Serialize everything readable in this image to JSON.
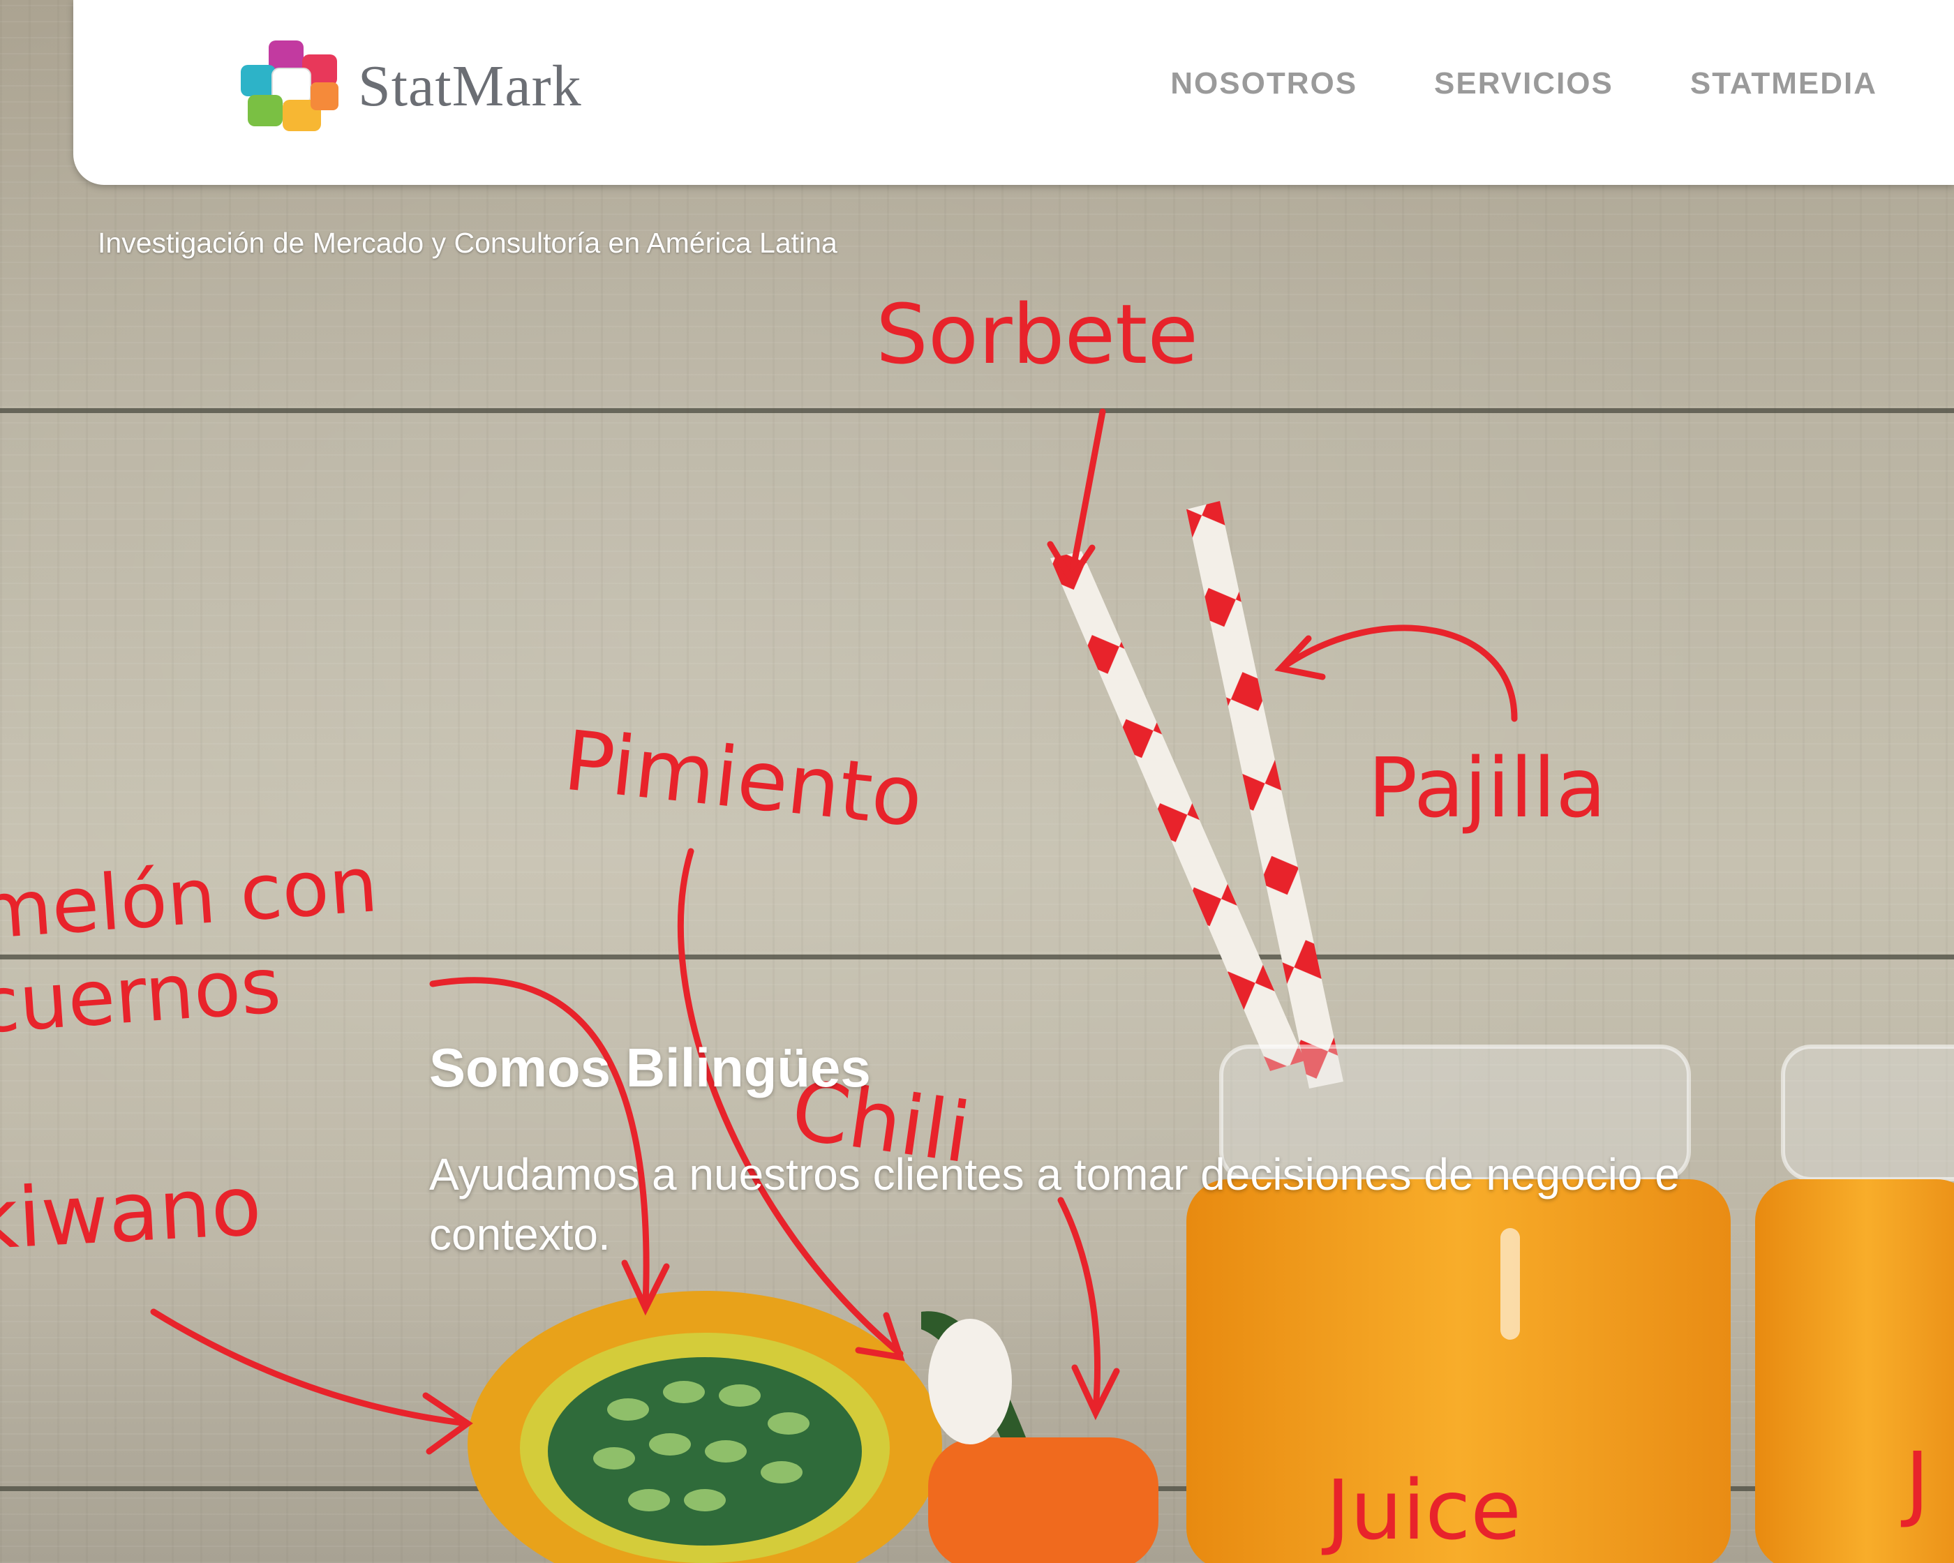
{
  "header": {
    "logo_text": "StatMark",
    "nav": [
      "NOSOTROS",
      "SERVICIOS",
      "STATMEDIA"
    ]
  },
  "hero": {
    "tagline": "Investigación de Mercado y Consultoría en América Latina",
    "title": "Somos Bilingües",
    "text_line1": "Ayudamos a nuestros clientes a tomar decisiones de negocio e",
    "text_line2": "contexto."
  },
  "illustration": {
    "labels": {
      "sorbete": "Sorbete",
      "pajilla": "Pajilla",
      "pimiento": "Pimiento",
      "melon_line1": "melón con",
      "melon_line2": "cuernos",
      "chili": "Chili",
      "kiwano": "kiwano",
      "juice": "Juice",
      "juice_partial": "J"
    }
  },
  "colors": {
    "accent_red": "#e8232b",
    "nav_gray": "#9a9a9a",
    "logo_gray": "#6b6e74"
  }
}
